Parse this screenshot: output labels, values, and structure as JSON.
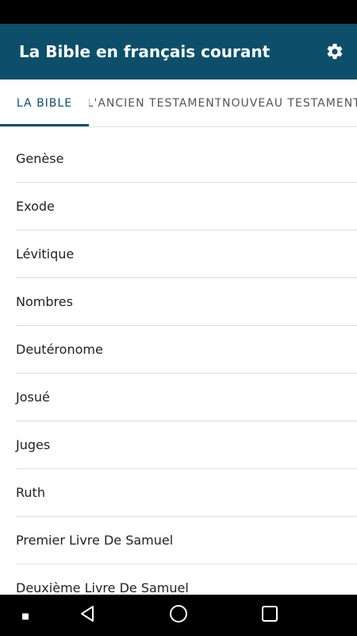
{
  "app": {
    "title": "La Bible en français courant",
    "settings_icon": "gear-icon"
  },
  "tabs": [
    {
      "label": "LA BIBLE",
      "active": true
    },
    {
      "label": "L'ANCIEN TESTAMENT",
      "active": false
    },
    {
      "label": "NOUVEAU TESTAMENT",
      "active": false
    }
  ],
  "books": [
    "Genèse",
    "Exode",
    "Lévitique",
    "Nombres",
    "Deutéronome",
    "Josué",
    "Juges",
    "Ruth",
    "Premier Livre De Samuel",
    "Deuxième Livre De Samuel"
  ],
  "colors": {
    "primary": "#0d4f6b",
    "statusbar": "#000000",
    "navbar": "#000000"
  },
  "navigation": {
    "back_icon": "back-triangle-icon",
    "home_icon": "home-circle-icon",
    "recents_icon": "recents-square-icon",
    "small_dot_icon": "dot-icon"
  }
}
